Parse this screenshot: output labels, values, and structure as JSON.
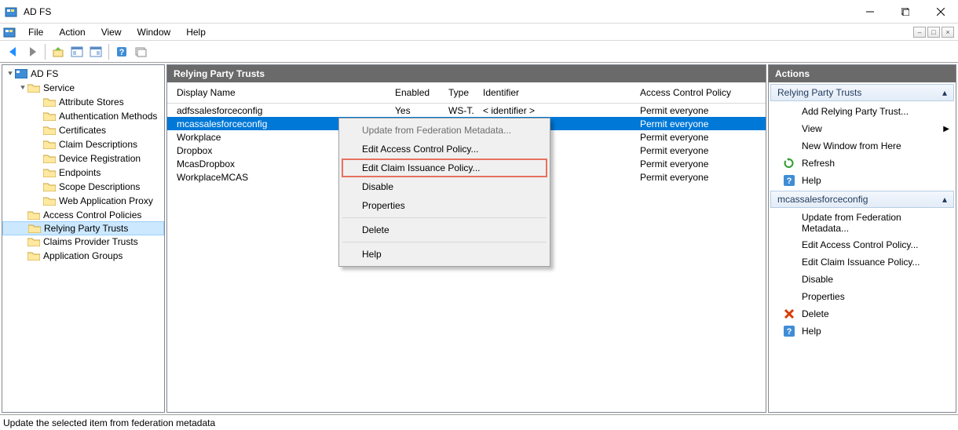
{
  "title": "AD FS",
  "menus": {
    "file": "File",
    "action": "Action",
    "view": "View",
    "window": "Window",
    "help": "Help"
  },
  "tree": {
    "root": "AD FS",
    "service": "Service",
    "items": [
      "Attribute Stores",
      "Authentication Methods",
      "Certificates",
      "Claim Descriptions",
      "Device Registration",
      "Endpoints",
      "Scope Descriptions",
      "Web Application Proxy"
    ],
    "postItems": [
      "Access Control Policies",
      "Relying Party Trusts",
      "Claims Provider Trusts",
      "Application Groups"
    ],
    "selectedIndex": 1
  },
  "list": {
    "header": "Relying Party Trusts",
    "columns": {
      "name": "Display Name",
      "enabled": "Enabled",
      "type": "Type",
      "identifier": "Identifier",
      "acp": "Access Control Policy"
    },
    "rows": [
      {
        "name": "adfssalesforceconfig",
        "enabled": "Yes",
        "type": "WS-T...",
        "identifier": "< identifier >",
        "acp": "Permit everyone"
      },
      {
        "name": "mcassalesforceconfig",
        "enabled": "",
        "type": "",
        "identifier": "",
        "acp": "Permit everyone",
        "selected": true
      },
      {
        "name": "Workplace",
        "enabled": "",
        "type": "",
        "identifier": "",
        "acp": "Permit everyone"
      },
      {
        "name": "Dropbox",
        "enabled": "",
        "type": "",
        "identifier": "",
        "acp": "Permit everyone"
      },
      {
        "name": "McasDropbox",
        "enabled": "",
        "type": "",
        "identifier": "",
        "acp": "Permit everyone"
      },
      {
        "name": "WorkplaceMCAS",
        "enabled": "",
        "type": "",
        "identifier": "",
        "acp": "Permit everyone"
      }
    ]
  },
  "contextMenu": {
    "items": [
      {
        "label": "Update from Federation Metadata...",
        "disabled": true
      },
      {
        "label": "Edit Access Control Policy..."
      },
      {
        "label": "Edit Claim Issuance Policy...",
        "highlighted": true
      },
      {
        "label": "Disable"
      },
      {
        "label": "Properties"
      },
      {
        "sep": true
      },
      {
        "label": "Delete"
      },
      {
        "sep": true
      },
      {
        "label": "Help"
      }
    ]
  },
  "actions": {
    "header": "Actions",
    "group1": {
      "title": "Relying Party Trusts",
      "items": [
        {
          "label": "Add Relying Party Trust...",
          "icon": "blank"
        },
        {
          "label": "View",
          "icon": "blank",
          "submenu": true
        },
        {
          "label": "New Window from Here",
          "icon": "blank"
        },
        {
          "label": "Refresh",
          "icon": "refresh"
        },
        {
          "label": "Help",
          "icon": "help"
        }
      ]
    },
    "group2": {
      "title": "mcassalesforceconfig",
      "items": [
        {
          "label": "Update from Federation Metadata...",
          "icon": "blank"
        },
        {
          "label": "Edit Access Control Policy...",
          "icon": "blank"
        },
        {
          "label": "Edit Claim Issuance Policy...",
          "icon": "blank"
        },
        {
          "label": "Disable",
          "icon": "blank"
        },
        {
          "label": "Properties",
          "icon": "blank"
        },
        {
          "label": "Delete",
          "icon": "delete"
        },
        {
          "label": "Help",
          "icon": "help"
        }
      ]
    }
  },
  "status": "Update the selected item from federation metadata"
}
